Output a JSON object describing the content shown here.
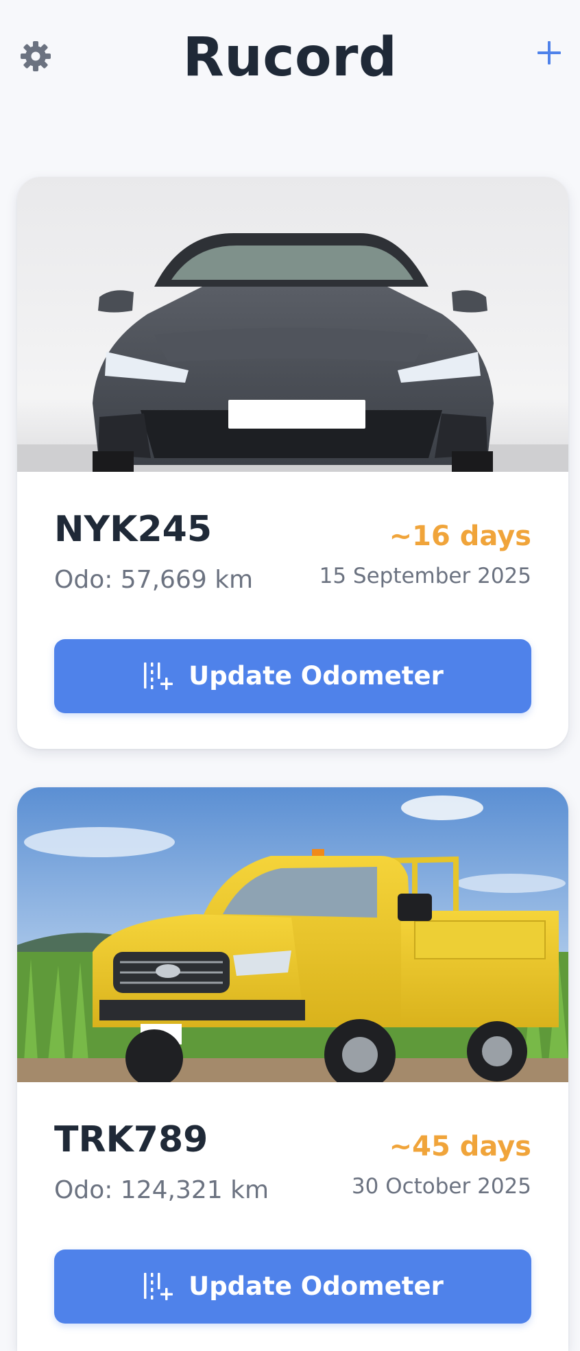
{
  "app": {
    "title": "Rucord",
    "settings_icon": "gear-icon",
    "add_icon": "plus-icon",
    "accent": "#4f82ea",
    "warning": "#f0a43a"
  },
  "vehicles": [
    {
      "plate": "NYK245",
      "odometer": "Odo: 57,669 km",
      "due_in": "~16 days",
      "due_date": "15 September 2025",
      "button_label": "Update Odometer",
      "button_icon": "odometer-update-icon",
      "image": "grey-sedan-front-photo"
    },
    {
      "plate": "TRK789",
      "odometer": "Odo: 124,321 km",
      "due_in": "~45 days",
      "due_date": "30 October 2025",
      "button_label": "Update Odometer",
      "button_icon": "odometer-update-icon",
      "image": "yellow-pickup-truck-photo"
    }
  ]
}
